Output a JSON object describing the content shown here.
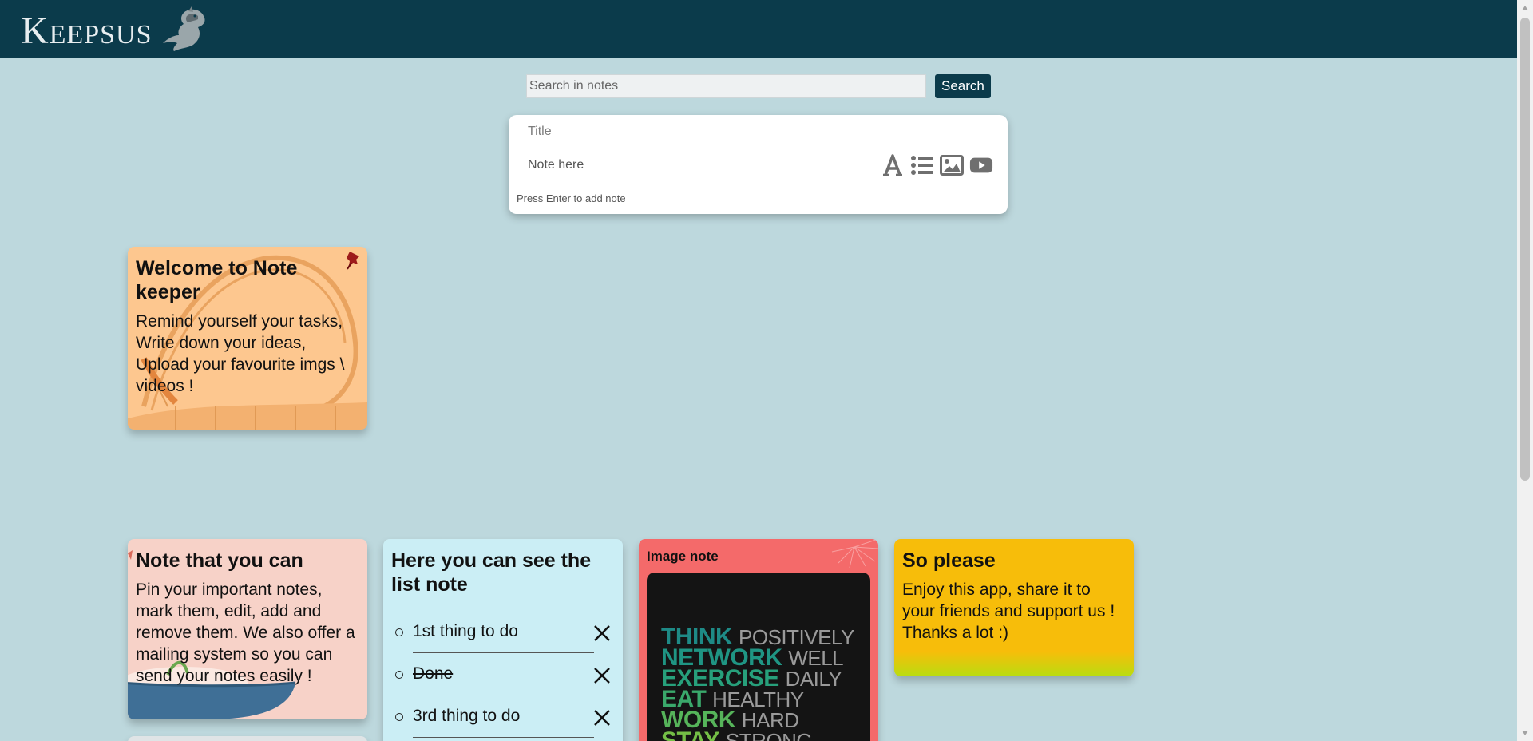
{
  "app": {
    "logo_text": "Keepsus"
  },
  "search": {
    "placeholder": "Search in notes",
    "button_label": "Search"
  },
  "composer": {
    "title_placeholder": "Title",
    "note_placeholder": "Note here",
    "hint": "Press Enter to add note",
    "tools": [
      "text-format-icon",
      "list-icon",
      "image-icon",
      "video-icon"
    ]
  },
  "notes": {
    "welcome": {
      "title": "Welcome to Note keeper",
      "body": "Remind yourself your tasks, Write down your ideas, Upload your favourite imgs \\ videos !",
      "color": "#fdc78f",
      "pinned": true
    },
    "features": {
      "title": "Note that you can",
      "body": "Pin your important notes, mark them, edit, add and remove them. We also offer a mailing system so you can send your notes easily !",
      "color": "#f7d2c8"
    },
    "list": {
      "title": "Here you can see the list note",
      "color": "#cbeef5",
      "items": [
        {
          "text": "1st thing to do",
          "done": false
        },
        {
          "text": "Done",
          "done": true
        },
        {
          "text": "3rd thing to do",
          "done": false
        }
      ]
    },
    "image": {
      "label": "Image note",
      "color": "#f46a6a",
      "poster": [
        {
          "bold": "THINK",
          "light": "POSITIVELY"
        },
        {
          "bold": "NETWORK",
          "light": "WELL"
        },
        {
          "bold": "EXERCISE",
          "light": "DAILY"
        },
        {
          "bold": "EAT",
          "light": "HEALTHY"
        },
        {
          "bold": "WORK",
          "light": "HARD"
        },
        {
          "bold": "STAY",
          "light": "STRONG"
        }
      ]
    },
    "please": {
      "title": "So please",
      "body": "Enjoy this app, share it to your friends and support us ! Thanks a lot :)",
      "color": "#f7bd0a"
    }
  }
}
